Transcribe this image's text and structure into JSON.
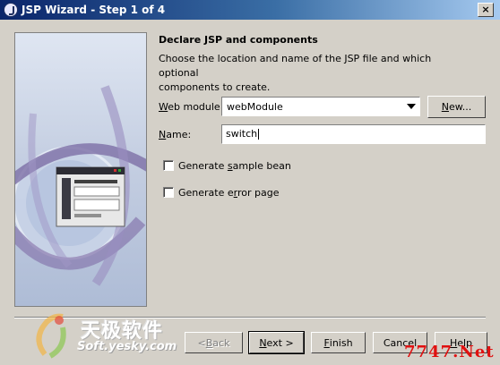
{
  "window": {
    "title": "JSP Wizard - Step 1 of 4"
  },
  "panel": {
    "heading": "Declare JSP and components",
    "description_lines": [
      "Choose the location and name of the JSP file and which optional",
      "components to create."
    ]
  },
  "web_module": {
    "label_pre": "W",
    "label_post": "eb module:",
    "value": "webModule",
    "new_label_pre": "N",
    "new_label_post": "ew..."
  },
  "name_field": {
    "label_pre": "N",
    "label_post": "ame:",
    "value": "switch"
  },
  "options": [
    {
      "label_pre": "Generate ",
      "label_u": "s",
      "label_post": "ample bean",
      "checked": false
    },
    {
      "label_pre": "Generate e",
      "label_u": "r",
      "label_post": "ror page",
      "checked": false
    }
  ],
  "buttons": {
    "back": {
      "pre": "< ",
      "u": "B",
      "post": "ack",
      "enabled": false
    },
    "next": {
      "pre": "",
      "u": "N",
      "post": "ext >",
      "enabled": true
    },
    "finish": {
      "pre": "",
      "u": "F",
      "post": "inish",
      "enabled": true
    },
    "cancel": {
      "label": "Cancel"
    },
    "help": {
      "pre": "",
      "u": "H",
      "post": "elp"
    }
  },
  "watermarks": {
    "cn_text": "天极软件",
    "site": "Soft.yesky.com",
    "corner": "7747.Net"
  },
  "colors": {
    "face": "#d4d0c8",
    "title_start": "#0a246a",
    "title_end": "#a6caf0",
    "watermark_red": "#e01010"
  }
}
